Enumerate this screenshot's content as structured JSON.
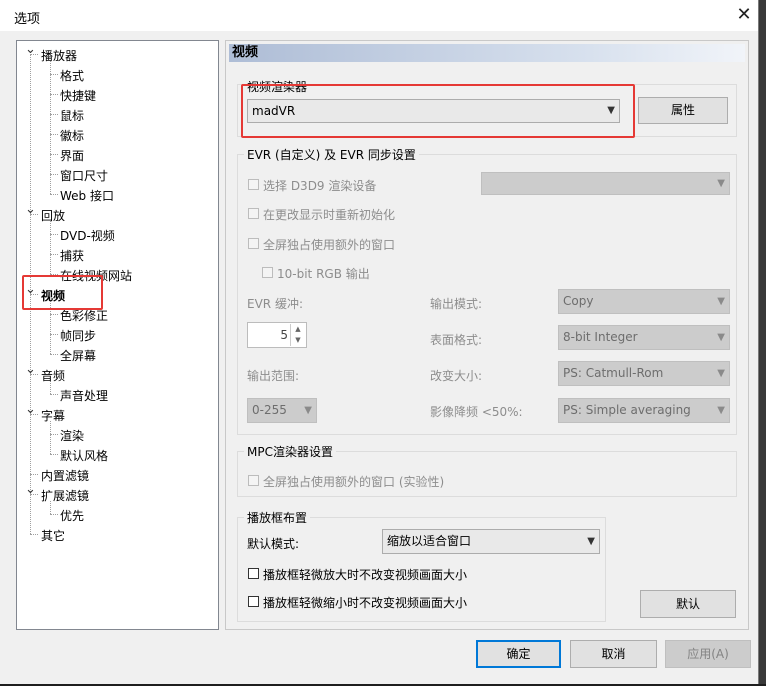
{
  "window": {
    "title": "选项",
    "close_glyph": "✕"
  },
  "tree": [
    {
      "label": "播放器",
      "level": 0,
      "expanded": true
    },
    {
      "label": "格式",
      "level": 1
    },
    {
      "label": "快捷键",
      "level": 1
    },
    {
      "label": "鼠标",
      "level": 1
    },
    {
      "label": "徽标",
      "level": 1
    },
    {
      "label": "界面",
      "level": 1
    },
    {
      "label": "窗口尺寸",
      "level": 1
    },
    {
      "label": "Web 接口",
      "level": 1
    },
    {
      "label": "回放",
      "level": 0,
      "expanded": true
    },
    {
      "label": "DVD-视频",
      "level": 1
    },
    {
      "label": "捕获",
      "level": 1
    },
    {
      "label": "在线视频网站",
      "level": 1
    },
    {
      "label": "视频",
      "level": 0,
      "expanded": true,
      "selected": true
    },
    {
      "label": "色彩修正",
      "level": 1
    },
    {
      "label": "帧同步",
      "level": 1
    },
    {
      "label": "全屏幕",
      "level": 1
    },
    {
      "label": "音频",
      "level": 0,
      "expanded": true
    },
    {
      "label": "声音处理",
      "level": 1
    },
    {
      "label": "字幕",
      "level": 0,
      "expanded": true
    },
    {
      "label": "渲染",
      "level": 1
    },
    {
      "label": "默认风格",
      "level": 1
    },
    {
      "label": "内置滤镜",
      "level": 0
    },
    {
      "label": "扩展滤镜",
      "level": 0,
      "expanded": true
    },
    {
      "label": "优先",
      "level": 1
    },
    {
      "label": "其它",
      "level": 0
    }
  ],
  "panel": {
    "header": "视频",
    "renderer_group": {
      "title": "视频渲染器",
      "value": "madVR",
      "properties_button": "属性"
    },
    "evr_group": {
      "title": "EVR (自定义) 及 EVR 同步设置",
      "select_d3d9": "选择 D3D9 渲染设备",
      "reinit_on_display_change": "在更改显示时重新初始化",
      "fullscreen_extra_window": "全屏独占使用额外的窗口",
      "output_10bit": "10-bit RGB 输出",
      "evr_buffer_label": "EVR 缓冲:",
      "evr_buffer_value": "5",
      "output_mode_label": "输出模式:",
      "output_mode_value": "Copy",
      "surface_format_label": "表面格式:",
      "surface_format_value": "8-bit Integer",
      "output_range_label": "输出范围:",
      "output_range_value": "0-255",
      "resize_label": "改变大小:",
      "resize_value": "PS: Catmull-Rom",
      "downscale_label": "影像降频 <50%:",
      "downscale_value": "PS: Simple averaging"
    },
    "mpc_group": {
      "title": "MPC渲染器设置",
      "fullscreen_extra_window": "全屏独占使用额外的窗口 (实验性)"
    },
    "layout_group": {
      "title": "播放框布置",
      "default_mode_label": "默认模式:",
      "default_mode_value": "缩放以适合窗口",
      "keep_on_zoom_in": "播放框轻微放大时不改变视频画面大小",
      "keep_on_zoom_out": "播放框轻微缩小时不改变视频画面大小"
    },
    "default_button": "默认"
  },
  "footer": {
    "ok": "确定",
    "cancel": "取消",
    "apply": "应用(A)"
  },
  "colors": {
    "highlight": "#e53935",
    "focus_border": "#0078d7"
  }
}
